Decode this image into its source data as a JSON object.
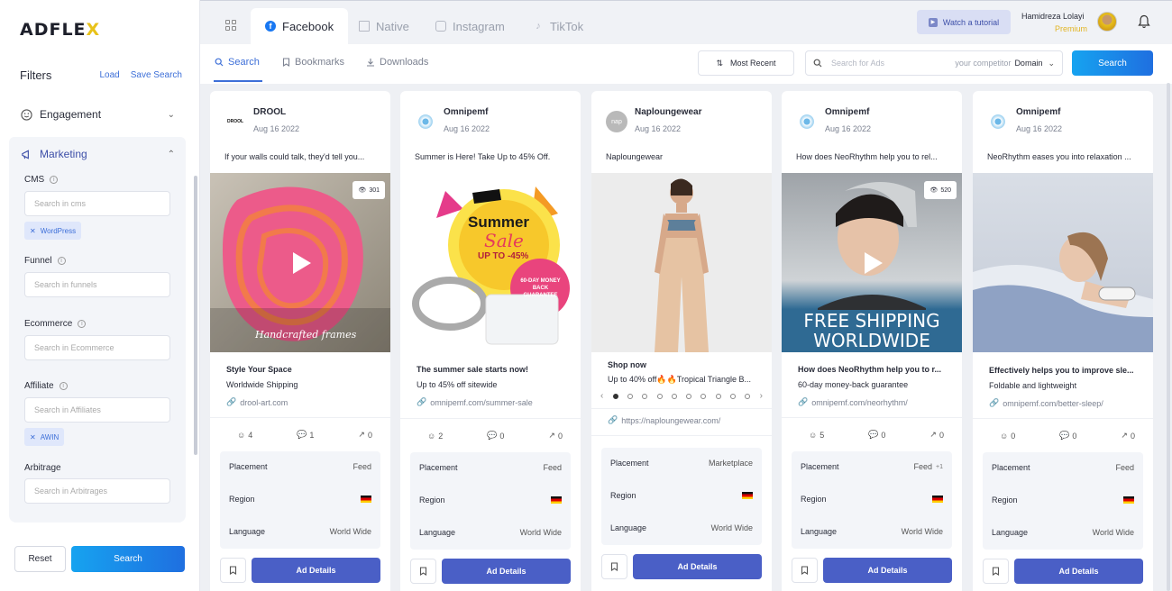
{
  "app": {
    "logo_main": "ADFLE",
    "logo_accent": "X"
  },
  "filters": {
    "title": "Filters",
    "load": "Load",
    "save_search": "Save Search",
    "engagement": "Engagement",
    "marketing": "Marketing",
    "fields": [
      {
        "label": "CMS",
        "placeholder": "Search in cms",
        "chip": "WordPress"
      },
      {
        "label": "Funnel",
        "placeholder": "Search in funnels"
      },
      {
        "label": "Ecommerce",
        "placeholder": "Search in Ecommerce"
      },
      {
        "label": "Affiliate",
        "placeholder": "Search in Affiliates",
        "chip": "AWIN"
      },
      {
        "label": "Arbitrage",
        "placeholder": "Search in Arbitrages"
      }
    ],
    "reset": "Reset",
    "search": "Search"
  },
  "platform_tabs": [
    "Facebook",
    "Native",
    "Instagram",
    "TikTok"
  ],
  "header": {
    "tutorial": "Watch a tutorial",
    "user_name": "Hamidreza Lolayi",
    "user_plan": "Premium"
  },
  "subtabs": [
    "Search",
    "Bookmarks",
    "Downloads"
  ],
  "toolbar": {
    "sort": "Most Recent",
    "search_placeholder": "Search for Ads",
    "competitor": "your competitor",
    "domain": "Domain",
    "search_button": "Search"
  },
  "labels": {
    "placement": "Placement",
    "region": "Region",
    "language": "Language",
    "ad_details": "Ad Details"
  },
  "cards": [
    {
      "name": "DROOL",
      "date": "Aug 16 2022",
      "desc": "If your walls could talk, they'd tell you...",
      "views": "301",
      "media_caption": "Handcrafted frames",
      "headline": "Style Your Space",
      "sub": "Worldwide Shipping",
      "link": "drool-art.com",
      "likes": "4",
      "comments": "1",
      "shares": "0",
      "placement": "Feed",
      "placement_extra": "",
      "language": "World Wide"
    },
    {
      "name": "Omnipemf",
      "date": "Aug 16 2022",
      "desc": "Summer is Here! Take Up to 45% Off.",
      "media_title": "Summer",
      "media_script": "Sale",
      "media_off": "UP TO -45%",
      "media_badge": "60-DAY MONEY BACK GUARANTEE",
      "headline": "The summer sale starts now!",
      "sub": "Up to 45% off sitewide",
      "link": "omnipemf.com/summer-sale",
      "likes": "2",
      "comments": "0",
      "shares": "0",
      "placement": "Feed",
      "placement_extra": "",
      "language": "World Wide"
    },
    {
      "name": "Naploungewear",
      "date": "Aug 16 2022",
      "logo_text": "nap",
      "desc": "Naploungewear",
      "headline": "Shop now",
      "sub": "Up to 40% off🔥🔥Tropical Triangle B...",
      "link": "https://naploungewear.com/",
      "placement": "Marketplace",
      "placement_extra": "",
      "language": "World Wide"
    },
    {
      "name": "Omnipemf",
      "date": "Aug 16 2022",
      "desc": "How does NeoRhythm help you to rel...",
      "views": "520",
      "media_caption": "FREE SHIPPING WORLDWIDE",
      "headline": "How does NeoRhythm help you to r...",
      "sub": "60-day money-back guarantee",
      "link": "omnipemf.com/neorhythm/",
      "likes": "5",
      "comments": "0",
      "shares": "0",
      "placement": "Feed",
      "placement_extra": "+1",
      "language": "World Wide"
    },
    {
      "name": "Omnipemf",
      "date": "Aug 16 2022",
      "desc": "NeoRhythm eases you into relaxation ...",
      "headline": "Effectively helps you to improve sle...",
      "sub": "Foldable and lightweight",
      "link": "omnipemf.com/better-sleep/",
      "likes": "0",
      "comments": "0",
      "shares": "0",
      "placement": "Feed",
      "placement_extra": "",
      "language": "World Wide"
    }
  ]
}
